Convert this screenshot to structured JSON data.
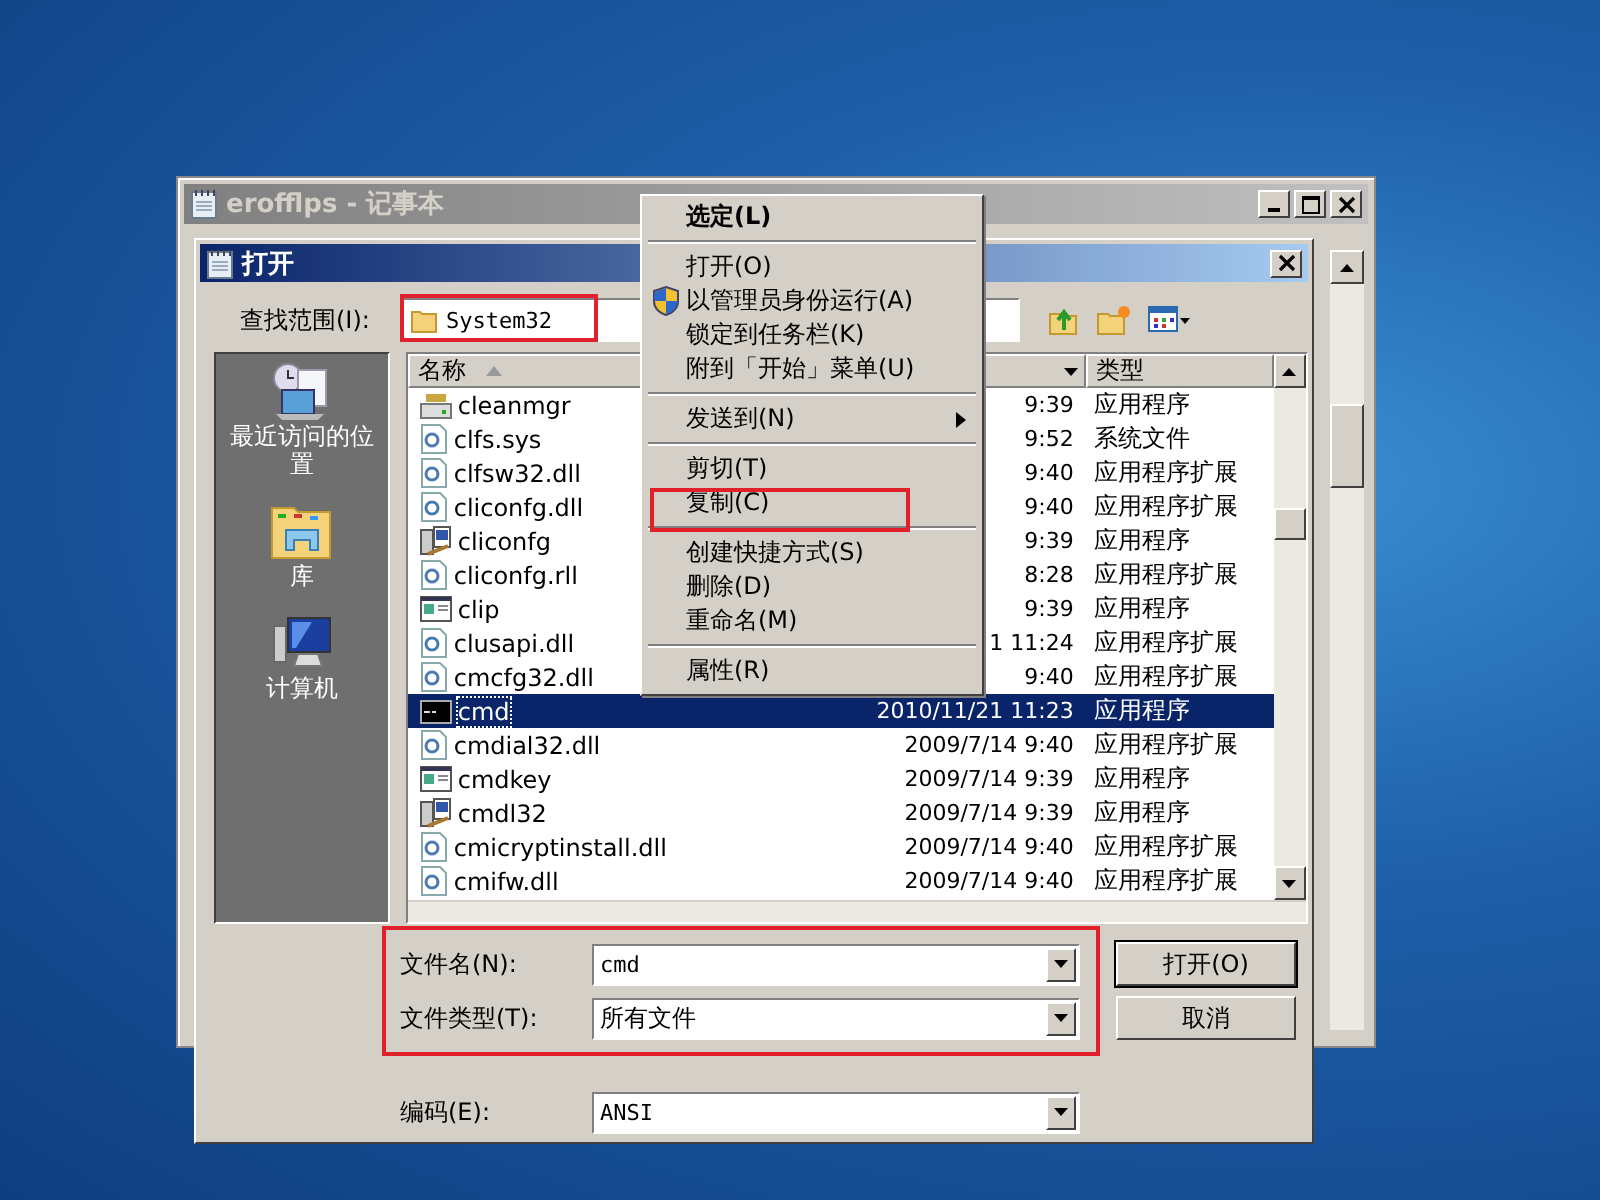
{
  "notepad": {
    "title": "erofflps - 记事本"
  },
  "dialog": {
    "title": "打开",
    "look_in": {
      "label": "查找范围(I):",
      "value": "System32"
    },
    "places": [
      {
        "label": "最近访问的位置",
        "kind": "recent"
      },
      {
        "label": "库",
        "kind": "library"
      },
      {
        "label": "计算机",
        "kind": "computer"
      }
    ],
    "columns": {
      "name": "名称",
      "type": "类型"
    },
    "files": [
      {
        "name": "cleanmgr",
        "date": "9:39",
        "type": "应用程序",
        "kind": "drive",
        "selected": false
      },
      {
        "name": "clfs.sys",
        "date": "9:52",
        "type": "系统文件",
        "kind": "gear",
        "selected": false
      },
      {
        "name": "clfsw32.dll",
        "date": "9:40",
        "type": "应用程序扩展",
        "kind": "gear",
        "selected": false
      },
      {
        "name": "cliconfg.dll",
        "date": "9:40",
        "type": "应用程序扩展",
        "kind": "gear",
        "selected": false
      },
      {
        "name": "cliconfg",
        "date": "9:39",
        "type": "应用程序",
        "kind": "tool",
        "selected": false
      },
      {
        "name": "cliconfg.rll",
        "date": "8:28",
        "type": "应用程序扩展",
        "kind": "gear",
        "selected": false
      },
      {
        "name": "clip",
        "date": "9:39",
        "type": "应用程序",
        "kind": "window",
        "selected": false
      },
      {
        "name": "clusapi.dll",
        "date": "1 11:24",
        "type": "应用程序扩展",
        "kind": "gear",
        "selected": false
      },
      {
        "name": "cmcfg32.dll",
        "date": "9:40",
        "type": "应用程序扩展",
        "kind": "gear",
        "selected": false
      },
      {
        "name": "cmd",
        "date": "2010/11/21 11:23",
        "type": "应用程序",
        "kind": "console",
        "selected": true
      },
      {
        "name": "cmdial32.dll",
        "date": "2009/7/14 9:40",
        "type": "应用程序扩展",
        "kind": "gear",
        "selected": false
      },
      {
        "name": "cmdkey",
        "date": "2009/7/14 9:39",
        "type": "应用程序",
        "kind": "window",
        "selected": false
      },
      {
        "name": "cmdl32",
        "date": "2009/7/14 9:39",
        "type": "应用程序",
        "kind": "tool",
        "selected": false
      },
      {
        "name": "cmicryptinstall.dll",
        "date": "2009/7/14 9:40",
        "type": "应用程序扩展",
        "kind": "gear",
        "selected": false
      },
      {
        "name": "cmifw.dll",
        "date": "2009/7/14 9:40",
        "type": "应用程序扩展",
        "kind": "gear",
        "selected": false
      }
    ],
    "file_name": {
      "label": "文件名(N):",
      "value": "cmd"
    },
    "file_type": {
      "label": "文件类型(T):",
      "value": "所有文件"
    },
    "encoding": {
      "label": "编码(E):",
      "value": "ANSI"
    },
    "buttons": [
      "打开(O)",
      "取消"
    ]
  },
  "context_menu": [
    {
      "kind": "item",
      "label": "选定(L)",
      "default": true,
      "shield": false,
      "submenu": false
    },
    {
      "kind": "separator"
    },
    {
      "kind": "item",
      "label": "打开(O)",
      "default": false,
      "shield": false,
      "submenu": false
    },
    {
      "kind": "item",
      "label": "以管理员身份运行(A)",
      "default": false,
      "shield": true,
      "submenu": false
    },
    {
      "kind": "item",
      "label": "锁定到任务栏(K)",
      "default": false,
      "shield": false,
      "submenu": false
    },
    {
      "kind": "item",
      "label": "附到「开始」菜单(U)",
      "default": false,
      "shield": false,
      "submenu": false
    },
    {
      "kind": "separator"
    },
    {
      "kind": "item",
      "label": "发送到(N)",
      "default": false,
      "shield": false,
      "submenu": true
    },
    {
      "kind": "separator"
    },
    {
      "kind": "item",
      "label": "剪切(T)",
      "default": false,
      "shield": false,
      "submenu": false
    },
    {
      "kind": "item",
      "label": "复制(C)",
      "default": false,
      "shield": false,
      "submenu": false
    },
    {
      "kind": "separator"
    },
    {
      "kind": "item",
      "label": "创建快捷方式(S)",
      "default": false,
      "shield": false,
      "submenu": false
    },
    {
      "kind": "item",
      "label": "删除(D)",
      "default": false,
      "shield": false,
      "submenu": false
    },
    {
      "kind": "item",
      "label": "重命名(M)",
      "default": false,
      "shield": false,
      "submenu": false
    },
    {
      "kind": "separator"
    },
    {
      "kind": "item",
      "label": "属性(R)",
      "default": false,
      "shield": false,
      "submenu": false
    }
  ]
}
